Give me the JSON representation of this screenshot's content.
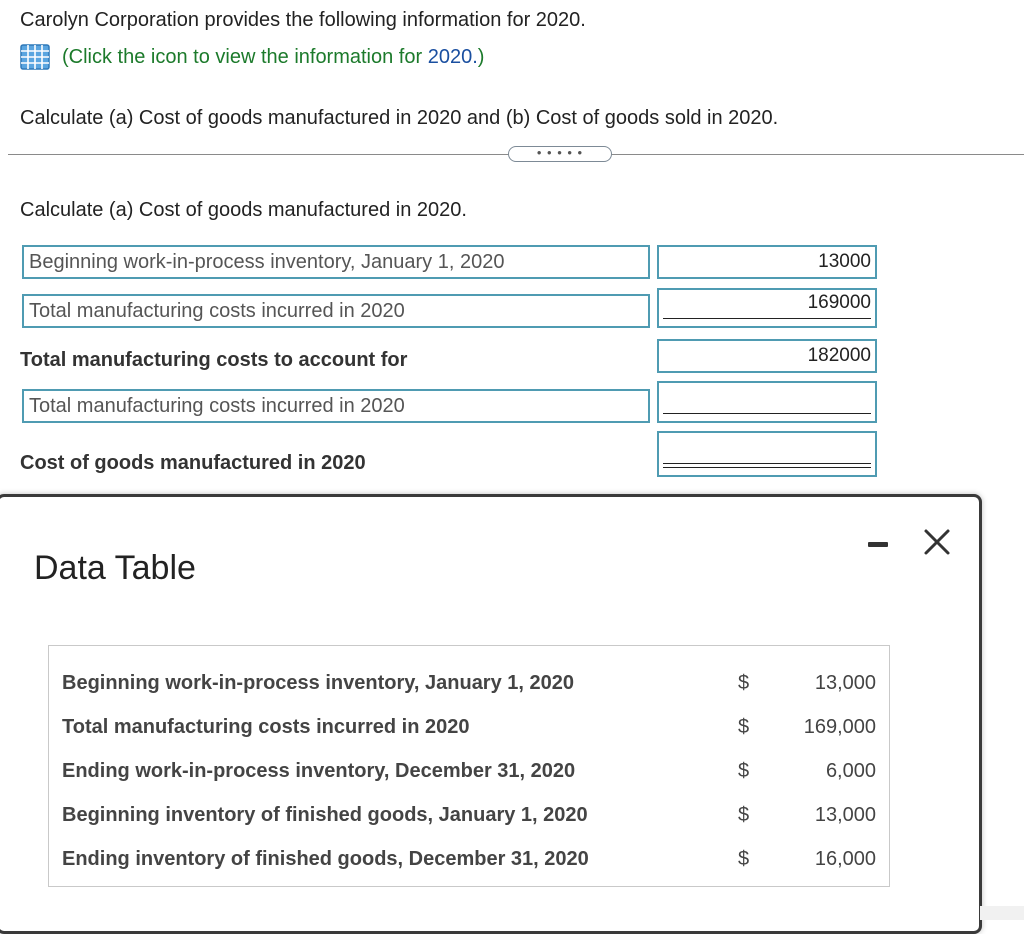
{
  "intro": "Carolyn Corporation provides the following information for 2020.",
  "info_link": {
    "text": "(Click the icon to view the information for ",
    "year": "2020.",
    "close": ")"
  },
  "instruction": "Calculate (a) Cost of goods manufactured in 2020 and (b) Cost of goods sold in 2020.",
  "expand_dots": "• • • • •",
  "section_a": {
    "title": "Calculate (a) Cost of goods manufactured in 2020.",
    "rows": [
      {
        "label": "Beginning work-in-process inventory, January 1, 2020",
        "value": "13000"
      },
      {
        "label": "Total manufacturing costs incurred in 2020",
        "value": "169000"
      },
      {
        "label": "Total manufacturing costs to account for",
        "value": "182000"
      },
      {
        "label": "Total manufacturing costs incurred in 2020",
        "value": ""
      },
      {
        "label": "Cost of goods manufactured in 2020",
        "value": ""
      }
    ]
  },
  "modal": {
    "title": "Data Table",
    "rows": [
      {
        "label": "Beginning work-in-process inventory, January 1, 2020",
        "currency": "$",
        "amount": "13,000"
      },
      {
        "label": "Total manufacturing costs incurred in 2020",
        "currency": "$",
        "amount": "169,000"
      },
      {
        "label": "Ending work-in-process inventory, December 31, 2020",
        "currency": "$",
        "amount": "6,000"
      },
      {
        "label": "Beginning inventory of finished goods, January 1, 2020",
        "currency": "$",
        "amount": "13,000"
      },
      {
        "label": "Ending inventory of finished goods, December 31, 2020",
        "currency": "$",
        "amount": "16,000"
      }
    ]
  },
  "icons": {
    "table": "table-grid-icon",
    "minimize": "minimize-icon",
    "close": "close-icon"
  },
  "colors": {
    "link_green": "#1c7a2b",
    "link_blue": "#1a4fa0",
    "field_border": "#4f9bb2"
  }
}
